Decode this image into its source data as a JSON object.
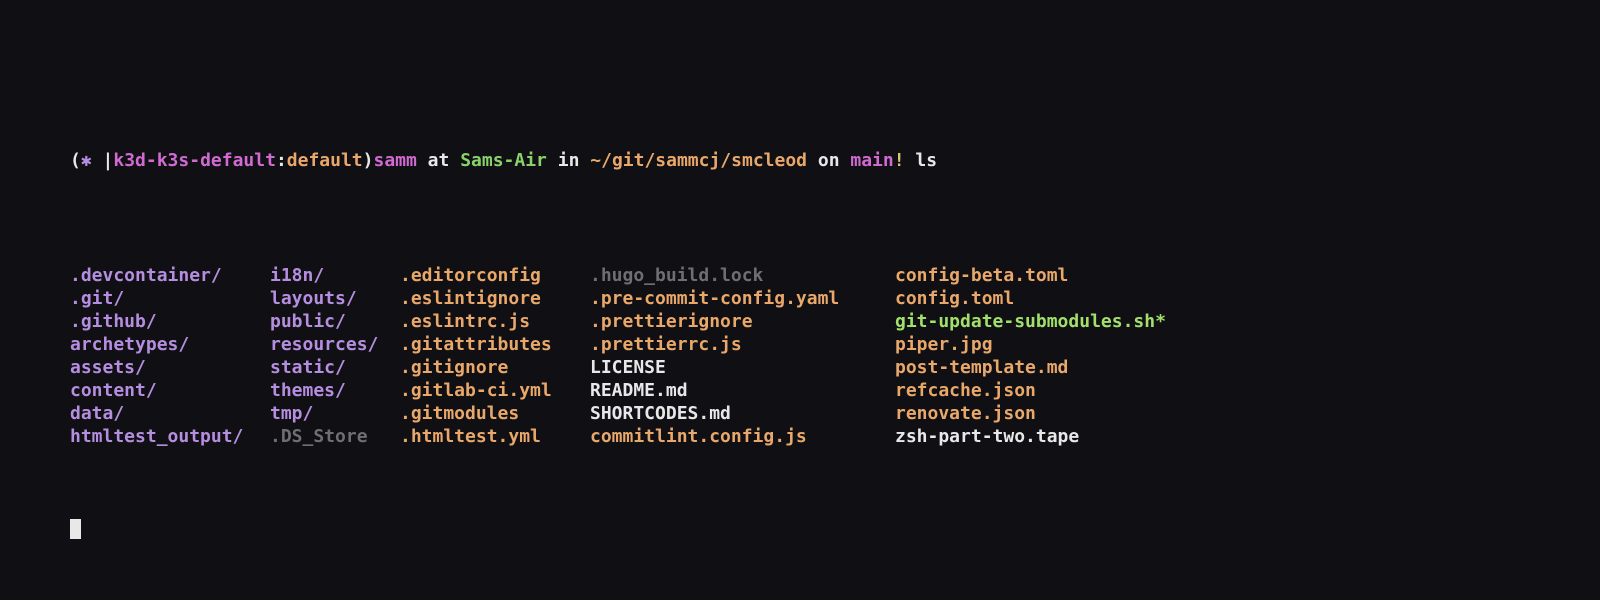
{
  "prompt": {
    "open_paren": "(",
    "star": "✱ ",
    "pipe": "|",
    "k8s_ctx": "k3d-k3s-default",
    "colon": ":",
    "k8s_ns": "default",
    "close_paren": ")",
    "user": "samm",
    "at": " at ",
    "host": "Sams-Air",
    "in": " in ",
    "path": "~/git/sammcj/smcleod",
    "on": " on ",
    "branch": "main",
    "dirty": "!",
    "cmd": " ls"
  },
  "ls": {
    "col1": [
      {
        "t": ".devcontainer/",
        "c": "c-purple"
      },
      {
        "t": ".git/",
        "c": "c-purple"
      },
      {
        "t": ".github/",
        "c": "c-purple"
      },
      {
        "t": "archetypes/",
        "c": "c-purple"
      },
      {
        "t": "assets/",
        "c": "c-purple"
      },
      {
        "t": "content/",
        "c": "c-purple"
      },
      {
        "t": "data/",
        "c": "c-purple"
      },
      {
        "t": "htmltest_output/",
        "c": "c-purple"
      }
    ],
    "col2": [
      {
        "t": "i18n/",
        "c": "c-purple"
      },
      {
        "t": "layouts/",
        "c": "c-purple"
      },
      {
        "t": "public/",
        "c": "c-purple"
      },
      {
        "t": "resources/",
        "c": "c-purple"
      },
      {
        "t": "static/",
        "c": "c-purple"
      },
      {
        "t": "themes/",
        "c": "c-purple"
      },
      {
        "t": "tmp/",
        "c": "c-purple"
      },
      {
        "t": ".DS_Store",
        "c": "c-grey"
      }
    ],
    "col3": [
      {
        "t": ".editorconfig",
        "c": "c-orange"
      },
      {
        "t": ".eslintignore",
        "c": "c-orange"
      },
      {
        "t": ".eslintrc.js",
        "c": "c-orange"
      },
      {
        "t": ".gitattributes",
        "c": "c-orange"
      },
      {
        "t": ".gitignore",
        "c": "c-orange"
      },
      {
        "t": ".gitlab-ci.yml",
        "c": "c-orange"
      },
      {
        "t": ".gitmodules",
        "c": "c-orange"
      },
      {
        "t": ".htmltest.yml",
        "c": "c-orange"
      }
    ],
    "col4": [
      {
        "t": ".hugo_build.lock",
        "c": "c-grey"
      },
      {
        "t": ".pre-commit-config.yaml",
        "c": "c-orange"
      },
      {
        "t": ".prettierignore",
        "c": "c-orange"
      },
      {
        "t": ".prettierrc.js",
        "c": "c-orange"
      },
      {
        "t": "LICENSE",
        "c": "c-white"
      },
      {
        "t": "README.md",
        "c": "c-white"
      },
      {
        "t": "SHORTCODES.md",
        "c": "c-white"
      },
      {
        "t": "commitlint.config.js",
        "c": "c-orange"
      }
    ],
    "col5": [
      {
        "t": "config-beta.toml",
        "c": "c-orange"
      },
      {
        "t": "config.toml",
        "c": "c-orange"
      },
      {
        "t": "git-update-submodules.sh",
        "c": "c-green2",
        "suffix": "*",
        "sc": "c-green2"
      },
      {
        "t": "piper.jpg",
        "c": "c-orange"
      },
      {
        "t": "post-template.md",
        "c": "c-orange"
      },
      {
        "t": "refcache.json",
        "c": "c-orange"
      },
      {
        "t": "renovate.json",
        "c": "c-orange"
      },
      {
        "t": "zsh-part-two.tape",
        "c": "c-white"
      }
    ]
  }
}
